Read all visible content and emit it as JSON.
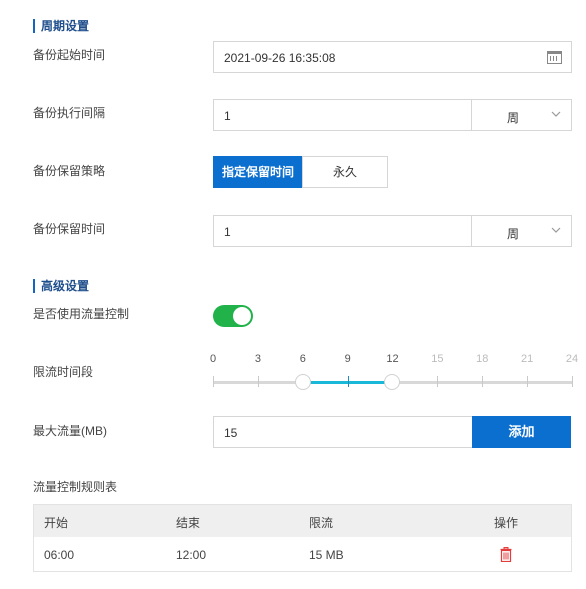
{
  "sections": {
    "cycle": "周期设置",
    "advanced": "高级设置"
  },
  "backup_start": {
    "label": "备份起始时间",
    "value": "2021-09-26 16:35:08",
    "icon": "calendar-icon"
  },
  "backup_interval": {
    "label": "备份执行间隔",
    "value": "1",
    "unit": "周"
  },
  "retention_policy": {
    "label": "备份保留策略",
    "options": [
      "指定保留时间",
      "永久"
    ],
    "selected": "指定保留时间"
  },
  "retention_time": {
    "label": "备份保留时间",
    "value": "1",
    "unit": "周"
  },
  "flow_control": {
    "label": "是否使用流量控制",
    "enabled": true
  },
  "limit_period": {
    "label": "限流时间段",
    "ticks": [
      "0",
      "3",
      "6",
      "9",
      "12",
      "15",
      "18",
      "21",
      "24"
    ],
    "range": [
      6,
      12
    ]
  },
  "max_flow": {
    "label": "最大流量(MB)",
    "value": "15",
    "add_label": "添加"
  },
  "rules_table": {
    "title": "流量控制规则表",
    "headers": [
      "开始",
      "结束",
      "限流",
      "操作"
    ],
    "rows": [
      {
        "start": "06:00",
        "end": "12:00",
        "limit": "15 MB",
        "action_icon": "trash-icon"
      }
    ]
  },
  "colors": {
    "primary": "#0b6fcf",
    "toggle_on": "#21b24a",
    "slider_fill": "#19b8d9",
    "delete": "#e23c3c"
  }
}
